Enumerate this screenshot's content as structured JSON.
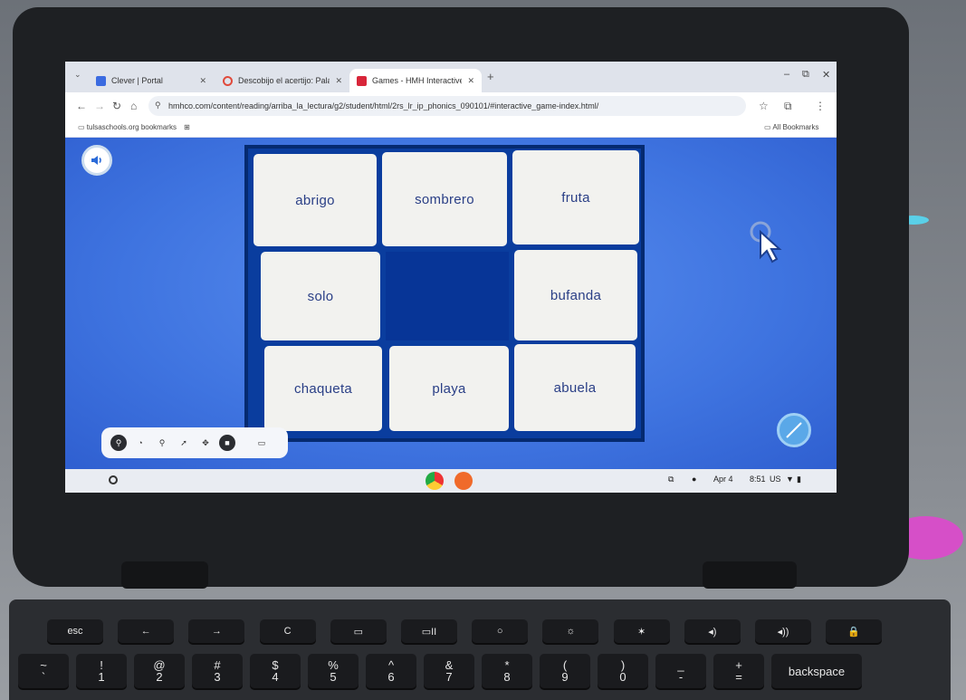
{
  "browser": {
    "tabs": [
      {
        "title": "Clever | Portal",
        "favicon_color": "#3b6be0"
      },
      {
        "title": "Descobijo el acertijo: Palabras",
        "favicon_color": "#e04a3b"
      },
      {
        "title": "Games - HMH Interactive Read",
        "favicon_color": "#d8263a"
      }
    ],
    "new_tab": "+",
    "window_controls": [
      "–",
      "⧉",
      "✕"
    ],
    "address": "hmhco.com/content/reading/arriba_la_lectura/g2/student/html/2rs_lr_ip_phonics_090101/#interactive_game-index.html/",
    "bookmarks": {
      "left": "tulsaschools.org bookmarks",
      "right": "All Bookmarks"
    }
  },
  "game": {
    "cards": [
      {
        "word": "abrigo",
        "empty": false
      },
      {
        "word": "sombrero",
        "empty": false
      },
      {
        "word": "fruta",
        "empty": false
      },
      {
        "word": "solo",
        "empty": false
      },
      {
        "word": "",
        "empty": true
      },
      {
        "word": "bufanda",
        "empty": false
      },
      {
        "word": "chaqueta",
        "empty": false
      },
      {
        "word": "playa",
        "empty": false
      },
      {
        "word": "abuela",
        "empty": false
      }
    ]
  },
  "shelf": {
    "date": "Apr 4",
    "time": "8:51",
    "locale": "US"
  },
  "keyboard": {
    "row1": [
      "esc",
      "←",
      "→",
      "C",
      "▭",
      "▭II",
      "○",
      "☼",
      "✶",
      "◂)",
      "◂))",
      "🔒"
    ],
    "row2": [
      {
        "top": "~",
        "bottom": "`"
      },
      {
        "top": "!",
        "bottom": "1"
      },
      {
        "top": "@",
        "bottom": "2"
      },
      {
        "top": "#",
        "bottom": "3"
      },
      {
        "top": "$",
        "bottom": "4"
      },
      {
        "top": "%",
        "bottom": "5"
      },
      {
        "top": "^",
        "bottom": "6"
      },
      {
        "top": "&",
        "bottom": "7"
      },
      {
        "top": "*",
        "bottom": "8"
      },
      {
        "top": "(",
        "bottom": "9"
      },
      {
        "top": ")",
        "bottom": "0"
      },
      {
        "top": "_",
        "bottom": "-"
      },
      {
        "top": "+",
        "bottom": "="
      },
      {
        "top": "",
        "bottom": "backspace"
      }
    ]
  }
}
